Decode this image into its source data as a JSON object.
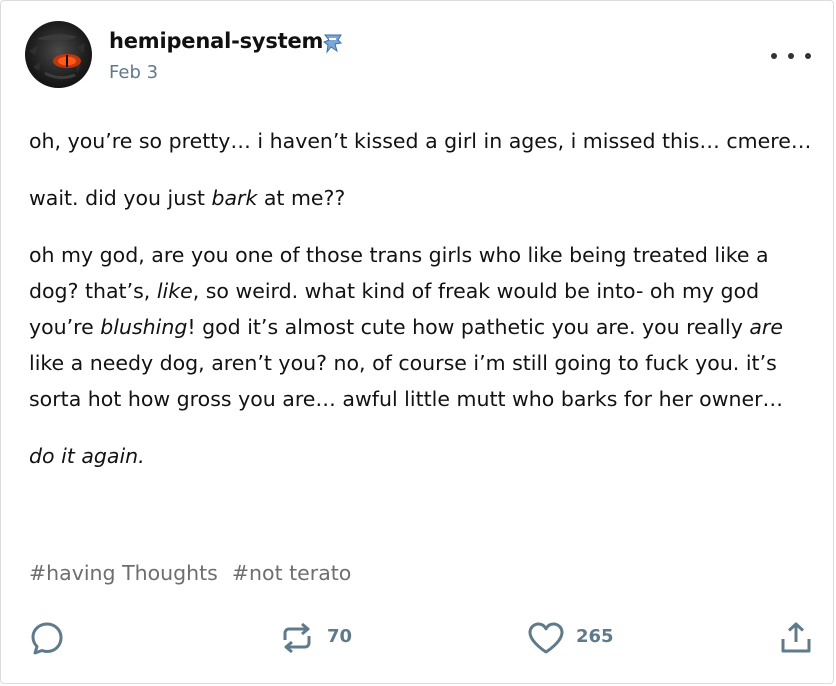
{
  "post": {
    "blog_name": "hemipenal-system",
    "date": "Feb 3",
    "paragraphs": [
      [
        {
          "t": "oh, you’re so pretty… i haven’t kissed a girl in ages, i missed this… cmere…"
        }
      ],
      [
        {
          "t": "wait. did you just "
        },
        {
          "t": "bark",
          "i": true
        },
        {
          "t": " at me??"
        }
      ],
      [
        {
          "t": "oh my god, are you one of those trans girls who like being treated like a dog? that’s, "
        },
        {
          "t": "like",
          "i": true
        },
        {
          "t": ", so weird. what kind of freak would be into- oh my god you’re "
        },
        {
          "t": "blushing",
          "i": true
        },
        {
          "t": "! god it’s almost cute how pathetic you are. you really "
        },
        {
          "t": "are",
          "i": true
        },
        {
          "t": " like a needy dog, aren’t you? no, of course i’m still going to fuck you. it’s sorta hot how gross you are… awful little mutt who barks for her owner…"
        }
      ],
      [
        {
          "t": "do it again.",
          "i": true
        }
      ]
    ],
    "tags": [
      "#having Thoughts",
      "#not terato"
    ]
  },
  "footer": {
    "reblog_count": "70",
    "like_count": "265"
  },
  "icons": {
    "avatar": "dragon-eye-avatar",
    "badge": "blue-blog-badge-icon",
    "more": "more-options-icon",
    "reply": "reply-bubble-icon",
    "reblog": "reblog-icon",
    "like": "heart-icon",
    "share": "share-icon"
  },
  "colors": {
    "meta": "#5f7a8a",
    "tags": "#6e6e6e",
    "text": "#121212"
  }
}
